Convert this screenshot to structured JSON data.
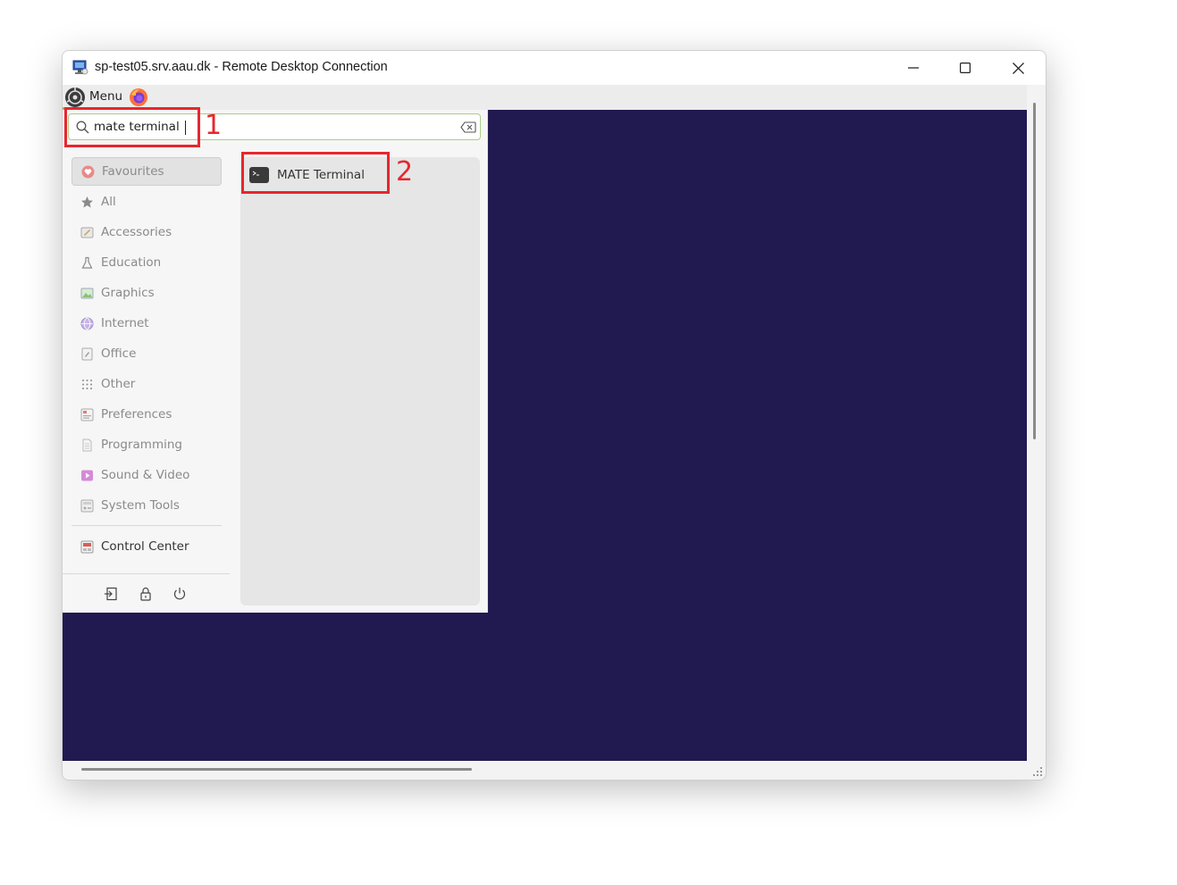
{
  "window": {
    "title": "sp-test05.srv.aau.dk - Remote Desktop Connection",
    "app_icon": "remote-desktop-icon",
    "controls": [
      "minimize-icon",
      "maximize-icon",
      "close-icon"
    ]
  },
  "panel": {
    "menu_label": "Menu",
    "launcher_icon": "firefox-icon"
  },
  "search": {
    "value": "mate terminal",
    "placeholder": ""
  },
  "categories": [
    {
      "label": "Favourites",
      "icon": "heart-icon",
      "selected": true
    },
    {
      "label": "All",
      "icon": "star-icon"
    },
    {
      "label": "Accessories",
      "icon": "accessories-icon"
    },
    {
      "label": "Education",
      "icon": "flask-icon"
    },
    {
      "label": "Graphics",
      "icon": "graphics-icon"
    },
    {
      "label": "Internet",
      "icon": "globe-icon"
    },
    {
      "label": "Office",
      "icon": "office-icon"
    },
    {
      "label": "Other",
      "icon": "grid-icon"
    },
    {
      "label": "Preferences",
      "icon": "preferences-icon"
    },
    {
      "label": "Programming",
      "icon": "document-icon"
    },
    {
      "label": "Sound & Video",
      "icon": "play-icon"
    },
    {
      "label": "System Tools",
      "icon": "system-tools-icon"
    }
  ],
  "control_center": {
    "label": "Control Center",
    "icon": "control-center-icon"
  },
  "results": [
    {
      "label": "MATE Terminal",
      "icon": "terminal-icon"
    }
  ],
  "session_buttons": [
    "logout-icon",
    "lock-icon",
    "power-icon"
  ],
  "annotations": [
    {
      "number": "1"
    },
    {
      "number": "2"
    }
  ],
  "colors": {
    "desktop": "#211a50",
    "annotation": "#e8262d",
    "search_border": "#a9cf85"
  }
}
